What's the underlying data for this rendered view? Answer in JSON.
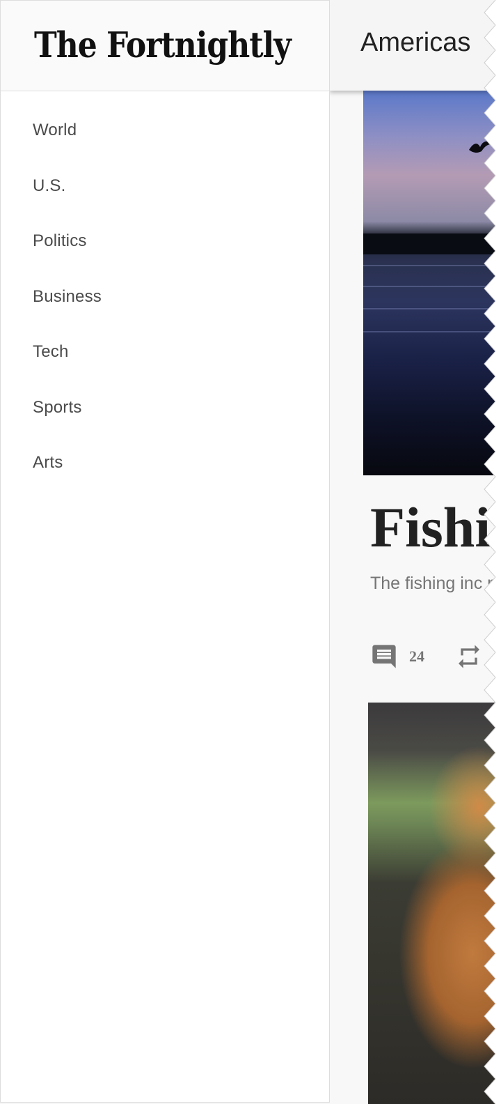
{
  "drawer": {
    "brand": "The Fortnightly",
    "nav_items": [
      "World",
      "U.S.",
      "Politics",
      "Business",
      "Tech",
      "Sports",
      "Arts"
    ]
  },
  "main": {
    "section_title": "Americas",
    "article": {
      "headline": "Fishi",
      "summary": "The fishing inc months due to",
      "comment_count": "24"
    }
  },
  "icons": {
    "comment": "comment-icon",
    "share": "repost-icon"
  },
  "colors": {
    "text_primary": "#212121",
    "text_secondary": "#757575",
    "nav_text": "#4a4a4a",
    "divider": "#dddddd"
  }
}
